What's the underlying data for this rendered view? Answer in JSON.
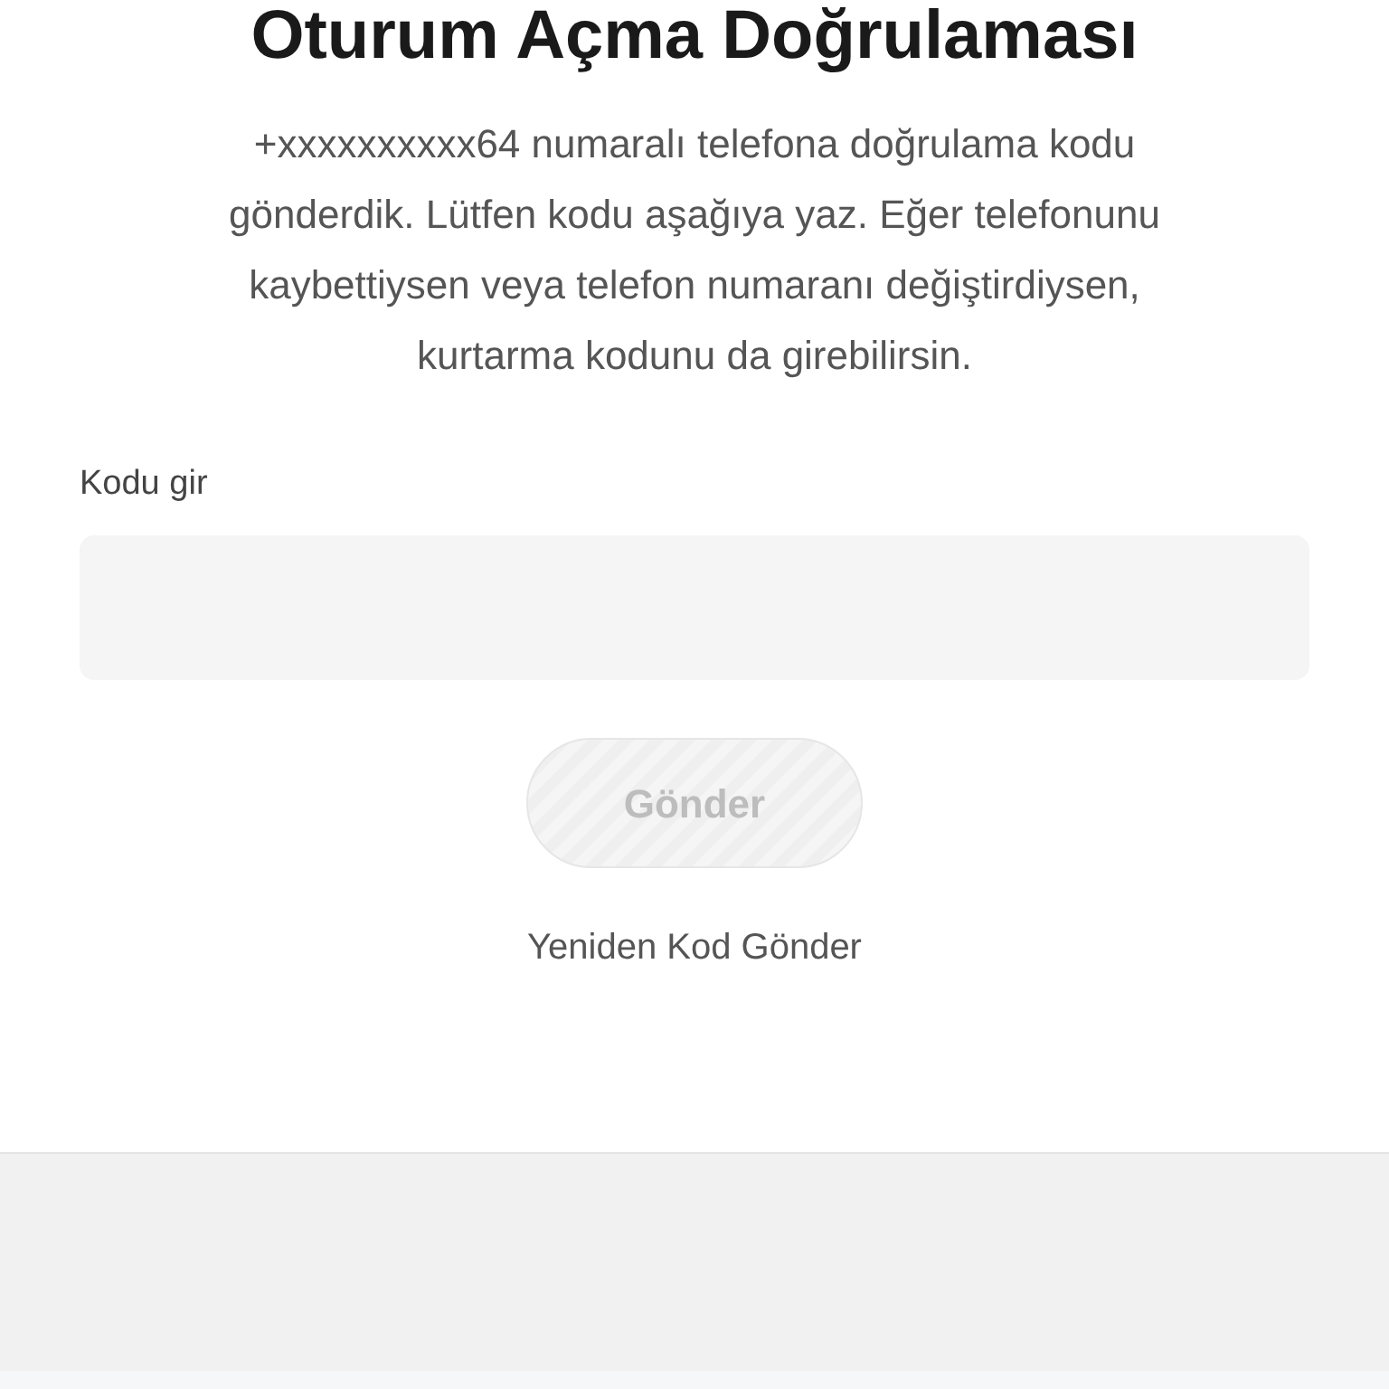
{
  "title": "Oturum Açma Doğrulaması",
  "message": "+xxxxxxxxxx64 numaralı telefona doğrulama kodu gönderdik. Lütfen kodu aşağıya yaz. Eğer telefonunu kaybettiysen veya telefon numaranı değiştirdiysen, kurtarma kodunu da girebilirsin.",
  "code_field": {
    "label": "Kodu gir"
  },
  "submit_button": {
    "label": "Gönder",
    "disabled": true
  },
  "resend_link": "Yeniden Kod Gönder"
}
